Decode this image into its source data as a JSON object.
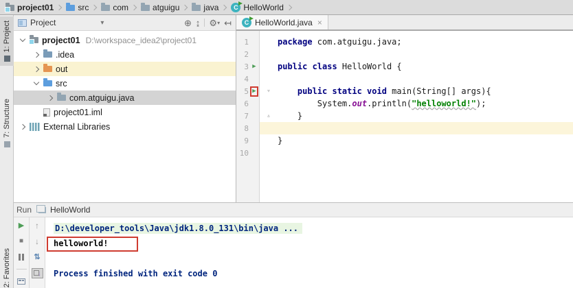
{
  "icons": {
    "close": "×",
    "run_arrow": "▶",
    "fold_open": "▿",
    "fold_close": "▵",
    "gear": "⚙",
    "locate": "⊕",
    "collapse_all": "↨",
    "hide": "↤",
    "dropdown": "▾",
    "stop": "■",
    "up": "↑",
    "down": "↓",
    "swap": "⇅",
    "pin_down": "↓",
    "class_letter": "C"
  },
  "breadcrumb": {
    "items": [
      {
        "label": "project01",
        "icon": "project-folder-icon"
      },
      {
        "label": "src",
        "icon": "source-folder-icon"
      },
      {
        "label": "com",
        "icon": "package-folder-icon"
      },
      {
        "label": "atguigu",
        "icon": "package-folder-icon"
      },
      {
        "label": "java",
        "icon": "package-folder-icon"
      },
      {
        "label": "HelloWorld",
        "icon": "java-class-icon"
      }
    ]
  },
  "tool_strip": {
    "project_tab": "1: Project",
    "structure_tab": "7: Structure",
    "favorites_tab": "2: Favorites"
  },
  "project_panel": {
    "title": "Project",
    "tree": [
      {
        "label": "project01",
        "path": "D:\\workspace_idea2\\project01",
        "state": "expanded",
        "icon": "project-folder"
      },
      {
        "label": ".idea",
        "state": "collapsed",
        "icon": "folder"
      },
      {
        "label": "out",
        "state": "collapsed",
        "icon": "excluded-folder",
        "highlighted": true
      },
      {
        "label": "src",
        "state": "expanded",
        "icon": "source-folder"
      },
      {
        "label": "com.atguigu.java",
        "state": "collapsed",
        "icon": "package-folder",
        "selected": true
      },
      {
        "label": "project01.iml",
        "icon": "iml-file"
      },
      {
        "label": "External Libraries",
        "state": "collapsed",
        "icon": "library"
      }
    ]
  },
  "editor": {
    "tab_title": "HelloWorld.java",
    "bottom_bar": "HelloWorld",
    "lines": [
      {
        "n": "1",
        "segments": [
          {
            "t": "package",
            "c": "kw"
          },
          {
            "t": " com.atguigu.java;",
            "c": "pl"
          }
        ]
      },
      {
        "n": "2",
        "segments": []
      },
      {
        "n": "3",
        "run_arrow": true,
        "segments": [
          {
            "t": "public class",
            "c": "kw"
          },
          {
            "t": " HelloWorld {",
            "c": "pl"
          }
        ]
      },
      {
        "n": "4",
        "segments": []
      },
      {
        "n": "5",
        "run_arrow": true,
        "red_box": true,
        "fold": "open",
        "segments": [
          {
            "t": "    ",
            "c": "pl"
          },
          {
            "t": "public static void",
            "c": "kw"
          },
          {
            "t": " main(String[] args){",
            "c": "pl"
          }
        ]
      },
      {
        "n": "6",
        "segments": [
          {
            "t": "        System.",
            "c": "pl"
          },
          {
            "t": "out",
            "c": "field"
          },
          {
            "t": ".println(",
            "c": "pl"
          },
          {
            "t": "\"helloworld!\"",
            "c": "str"
          },
          {
            "t": ");",
            "c": "pl"
          }
        ]
      },
      {
        "n": "7",
        "fold": "close",
        "segments": [
          {
            "t": "    }",
            "c": "pl"
          }
        ]
      },
      {
        "n": "8",
        "caret_line": true,
        "segments": []
      },
      {
        "n": "9",
        "segments": [
          {
            "t": "}",
            "c": "pl"
          }
        ]
      },
      {
        "n": "10",
        "segments": []
      }
    ]
  },
  "run_panel": {
    "title": "Run",
    "tab": "HelloWorld",
    "console": [
      {
        "text": "D:\\developer_tools\\Java\\jdk1.8.0_131\\bin\\java ...",
        "type": "command",
        "highlighted": true
      },
      {
        "text": "helloworld!",
        "type": "stdout",
        "red_box": true
      },
      {
        "text": "",
        "type": "blank"
      },
      {
        "text": "Process finished with exit code 0",
        "type": "system"
      }
    ]
  },
  "colors": {
    "keyword": "#000080",
    "string": "#008000",
    "field": "#871094",
    "annotation_red": "#cf3b30",
    "run_green": "#4f9e58",
    "selection_grey": "#d4d4d4",
    "caret_line_yellow": "#fcf5da",
    "console_cmd_highlight": "#e8f5e2"
  }
}
